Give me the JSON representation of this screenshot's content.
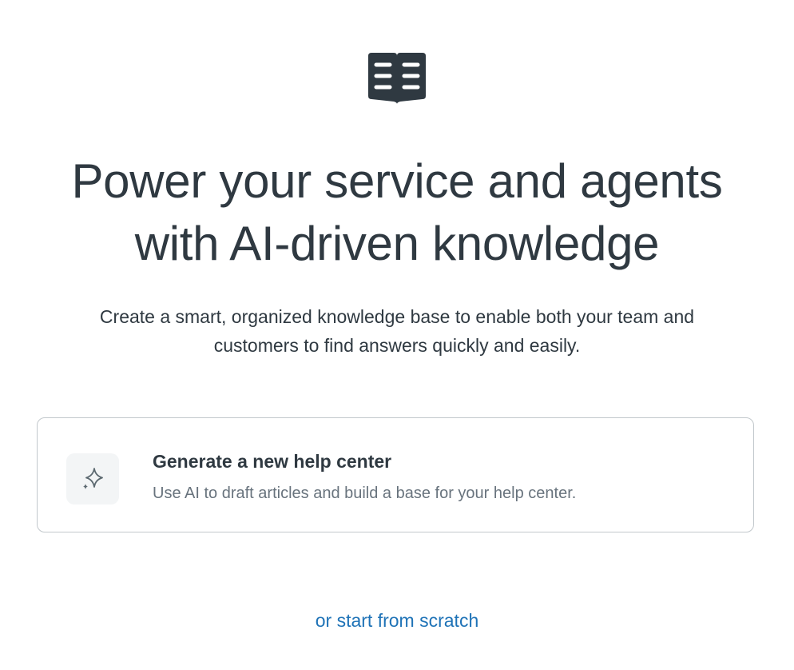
{
  "hero": {
    "icon": "open-book-icon",
    "headline_line1": "Power your service and agents",
    "headline_line2": "with AI-driven knowledge",
    "subtitle_line1": "Create a smart, organized knowledge base to enable both your team and",
    "subtitle_line2": "customers to find answers quickly and easily."
  },
  "generate_card": {
    "icon": "sparkle-icon",
    "title": "Generate a new help center",
    "description": "Use AI to draft articles and build a base for your help center."
  },
  "scratch_link": {
    "label": "or start from scratch"
  },
  "colors": {
    "text_primary": "#2f3941",
    "text_secondary": "#68737d",
    "link": "#1f73b7",
    "card_border": "#c2c8cc",
    "icon_box_bg": "#f3f5f6"
  }
}
